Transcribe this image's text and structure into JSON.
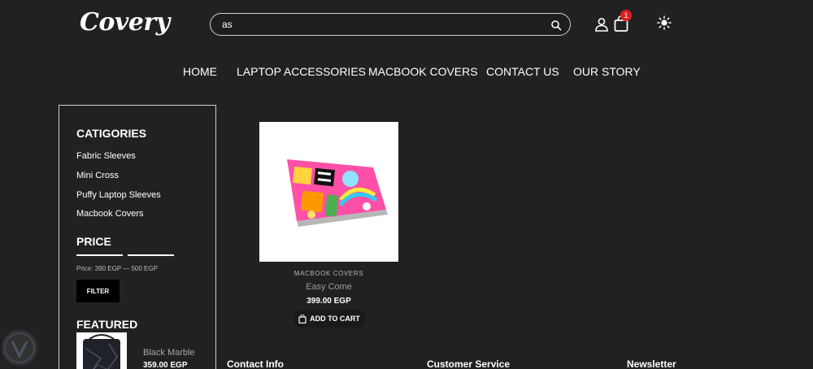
{
  "header": {
    "logo": "Covery",
    "search_value": "as",
    "cart_count": "1"
  },
  "nav": [
    "HOME",
    "LAPTOP ACCESSORIES",
    "MACBOOK COVERS",
    "CONTACT US",
    "OUR STORY"
  ],
  "sidebar": {
    "categories_title": "CATIGORIES",
    "categories": [
      "Fabric Sleeves",
      "Mini Cross",
      "Puffy Laptop Sleeves",
      "Macbook Covers"
    ],
    "price_title": "PRICE",
    "price_range": "Price: 390 EGP — 500 EGP",
    "filter_label": "FILTER",
    "featured_title": "FEATURED",
    "featured": {
      "name": "Black Marble",
      "price": "359.00 EGP"
    }
  },
  "product": {
    "category": "MACBOOK COVERS",
    "name": "Easy Come",
    "price": "399.00 EGP",
    "add_to_cart": "ADD TO CART"
  },
  "footer": [
    "Contact Info",
    "Customer Service",
    "Newsletter"
  ]
}
